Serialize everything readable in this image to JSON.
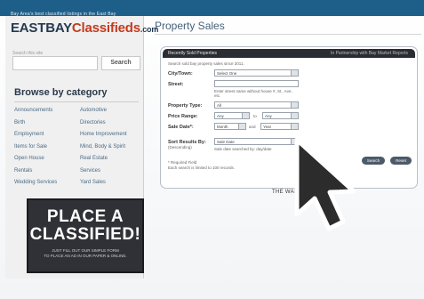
{
  "header": {
    "tagline": "Bay Area's best classified listings in the East Bay",
    "logo_main": "EASTBAY",
    "logo_accent": "Classifieds",
    "logo_suffix": ".com"
  },
  "sidebar": {
    "search_label": "Search this site",
    "search_placeholder": "",
    "search_button": "Search",
    "browse_title": "Browse by category",
    "categories_col1": [
      "Announcements",
      "Birth",
      "Employment",
      "Items for Sale",
      "Open House",
      "Rentals",
      "Wedding Services"
    ],
    "categories_col2": [
      "Automotive",
      "Directories",
      "Home Improvement",
      "Mind, Body & Spirit",
      "Real Estate",
      "Services",
      "Yard Sales"
    ],
    "place_title_1": "PLACE A",
    "place_title_2": "CLASSIFIED!",
    "place_sub_1": "JUST FILL OUT OUR SIMPLE FORM",
    "place_sub_2": "TO PLACE AN AD IN OUR PAPER & ONLINE."
  },
  "main": {
    "page_title": "Property Sales",
    "panel_title": "Recently Sold Properties",
    "panel_right": "In Partnership with Bay Market Reports",
    "panel_intro": "Search sold bay property sales since 2011.",
    "city_label": "City/Town:",
    "city_value": "Select One",
    "street_label": "Street:",
    "street_hint": "Enter street name without house #, St., Ave, etc.",
    "type_label": "Property Type:",
    "type_value": "All",
    "price_label": "Price Range:",
    "price_from": "Any",
    "price_to_label": "to",
    "price_to": "Any",
    "date_label": "Sale Date*:",
    "date_month": "Month",
    "date_and": "and",
    "date_year": "Year",
    "sort_label": "Sort Results By:",
    "sort_sub": "(Descending)",
    "sort_value": "Sale Date",
    "sort_hint": "Sale date searched by: day/date",
    "required_note": "* Required Field",
    "limit_note": "Each search is limited to 100 records.",
    "search_btn": "Search",
    "reset_btn": "Reset",
    "footer_logo": "THE WARREN GROUP"
  },
  "colors": {
    "top_band": "#1e5f8a",
    "logo_dark": "#243a52",
    "logo_accent": "#c23b1f",
    "panel_header": "#2a2d33",
    "place_box": "#2f3136"
  },
  "icons": [
    "mouse-pointer-arrow-icon"
  ]
}
